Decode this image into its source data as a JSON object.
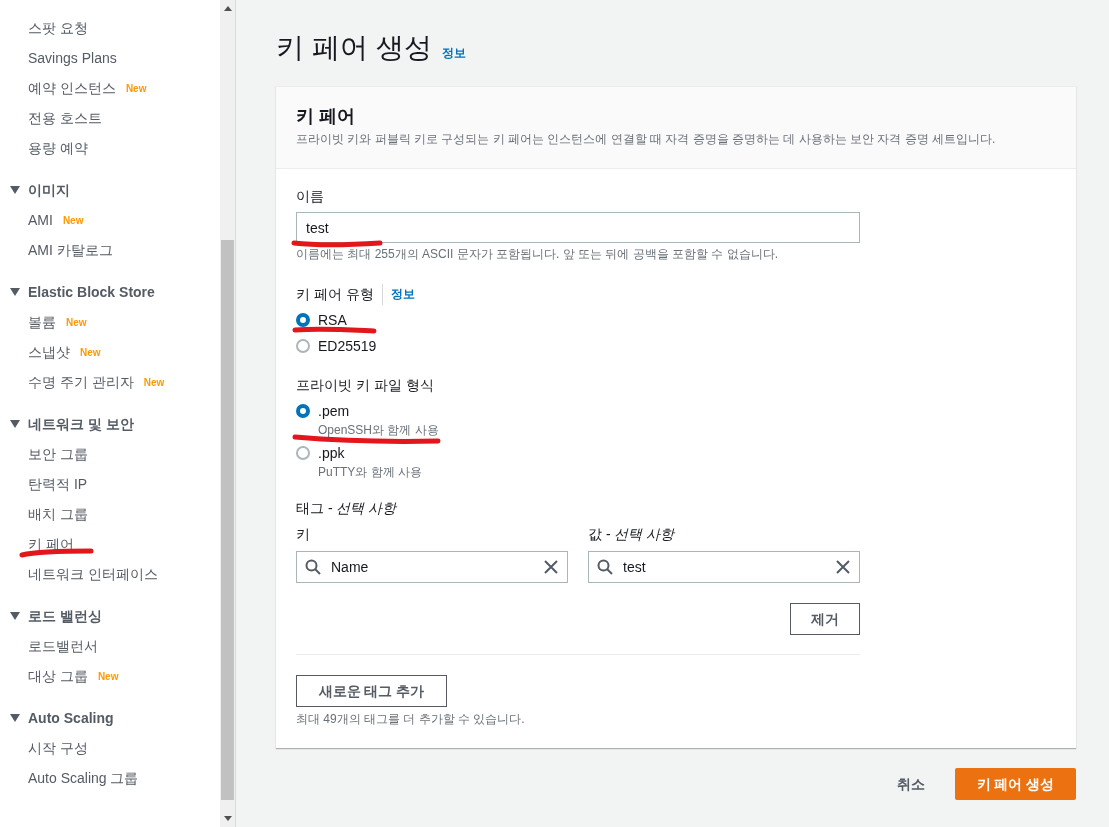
{
  "sidebar": {
    "items": [
      {
        "kind": "item",
        "label": "스팟 요청"
      },
      {
        "kind": "item",
        "label": "Savings Plans"
      },
      {
        "kind": "item",
        "label": "예약 인스턴스",
        "badge": "New"
      },
      {
        "kind": "item",
        "label": "전용 호스트"
      },
      {
        "kind": "item",
        "label": "용량 예약"
      },
      {
        "kind": "header",
        "label": "이미지",
        "expanded": true
      },
      {
        "kind": "item",
        "label": "AMI",
        "badge": "New"
      },
      {
        "kind": "item",
        "label": "AMI 카탈로그"
      },
      {
        "kind": "header",
        "label": "Elastic Block Store",
        "expanded": true
      },
      {
        "kind": "item",
        "label": "볼륨",
        "badge": "New"
      },
      {
        "kind": "item",
        "label": "스냅샷",
        "badge": "New"
      },
      {
        "kind": "item",
        "label": "수명 주기 관리자",
        "badge": "New"
      },
      {
        "kind": "header",
        "label": "네트워크 및 보안",
        "expanded": true
      },
      {
        "kind": "item",
        "label": "보안 그룹"
      },
      {
        "kind": "item",
        "label": "탄력적 IP"
      },
      {
        "kind": "item",
        "label": "배치 그룹"
      },
      {
        "kind": "item",
        "label": "키 페어",
        "annotated": true
      },
      {
        "kind": "item",
        "label": "네트워크 인터페이스"
      },
      {
        "kind": "header",
        "label": "로드 밸런싱",
        "expanded": true
      },
      {
        "kind": "item",
        "label": "로드밸런서"
      },
      {
        "kind": "item",
        "label": "대상 그룹",
        "badge": "New"
      },
      {
        "kind": "header",
        "label": "Auto Scaling",
        "expanded": true
      },
      {
        "kind": "item",
        "label": "시작 구성"
      },
      {
        "kind": "item",
        "label": "Auto Scaling 그룹"
      }
    ]
  },
  "page_title": "키 페어 생성",
  "title_info": "정보",
  "card": {
    "title": "키 페어",
    "description": "프라이빗 키와 퍼블릭 키로 구성되는 키 페어는 인스턴스에 연결할 때 자격 증명을 증명하는 데 사용하는 보안 자격 증명 세트입니다."
  },
  "name_field": {
    "label": "이름",
    "value": "test",
    "hint": "이름에는 최대 255개의 ASCII 문자가 포함됩니다. 앞 또는 뒤에 공백을 포함할 수 없습니다.",
    "annotated": true
  },
  "key_type": {
    "label": "키 페어 유형",
    "info": "정보",
    "options": [
      {
        "label": "RSA",
        "selected": true,
        "annotated": true
      },
      {
        "label": "ED25519",
        "selected": false
      }
    ]
  },
  "file_format": {
    "label": "프라이빗 키 파일 형식",
    "options": [
      {
        "label": ".pem",
        "description": "OpenSSH와 함께 사용",
        "selected": true,
        "annotated": true
      },
      {
        "label": ".ppk",
        "description": "PuTTY와 함께 사용",
        "selected": false
      }
    ]
  },
  "tags": {
    "label": "태그 - *선택 사항*",
    "key_label": "키",
    "value_label": "값 - *선택 사항*",
    "rows": [
      {
        "key": "Name",
        "value": "test"
      }
    ],
    "remove_button": "제거",
    "add_button": "새로운 태그 추가",
    "hint": "최대 49개의 태그를 더 추가할 수 있습니다."
  },
  "footer": {
    "cancel": "취소",
    "create": "키 페어 생성"
  }
}
